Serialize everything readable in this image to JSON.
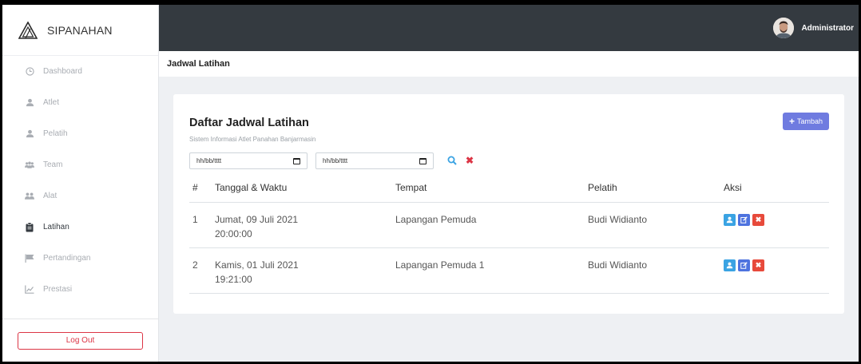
{
  "brand": {
    "name": "SIPANAHAN"
  },
  "sidebar": {
    "items": [
      {
        "label": "Dashboard",
        "icon": "clock-icon",
        "active": false
      },
      {
        "label": "Atlet",
        "icon": "user-icon",
        "active": false
      },
      {
        "label": "Pelatih",
        "icon": "user-icon",
        "active": false
      },
      {
        "label": "Team",
        "icon": "users-icon",
        "active": false
      },
      {
        "label": "Alat",
        "icon": "tools-icon",
        "active": false
      },
      {
        "label": "Latihan",
        "icon": "clipboard-icon",
        "active": true
      },
      {
        "label": "Pertandingan",
        "icon": "flag-icon",
        "active": false
      },
      {
        "label": "Prestasi",
        "icon": "chart-line-icon",
        "active": false
      }
    ],
    "logout_label": "Log Out"
  },
  "topbar": {
    "user_name": "Administrator"
  },
  "page": {
    "title": "Jadwal Latihan"
  },
  "card": {
    "title": "Daftar Jadwal Latihan",
    "subtitle": "Sistem Informasi Atlet Panahan Banjarmasin",
    "add_label": "Tambah"
  },
  "filters": {
    "start_placeholder": "hh/bb/tttt",
    "end_placeholder": "hh/bb/tttt"
  },
  "table": {
    "headers": [
      "#",
      "Tanggal & Waktu",
      "Tempat",
      "Pelatih",
      "Aksi"
    ],
    "rows": [
      {
        "no": "1",
        "date": "Jumat, 09 Juli 2021",
        "time": "20:00:00",
        "place": "Lapangan Pemuda",
        "coach": "Budi Widianto"
      },
      {
        "no": "2",
        "date": "Kamis, 01 Juli 2021",
        "time": "19:21:00",
        "place": "Lapangan Pemuda 1",
        "coach": "Budi Widianto"
      }
    ]
  },
  "colors": {
    "topbar": "#343a40",
    "primary": "#6f7be0",
    "danger": "#dc3545",
    "info": "#3aa3e3",
    "edit": "#4e73df"
  }
}
